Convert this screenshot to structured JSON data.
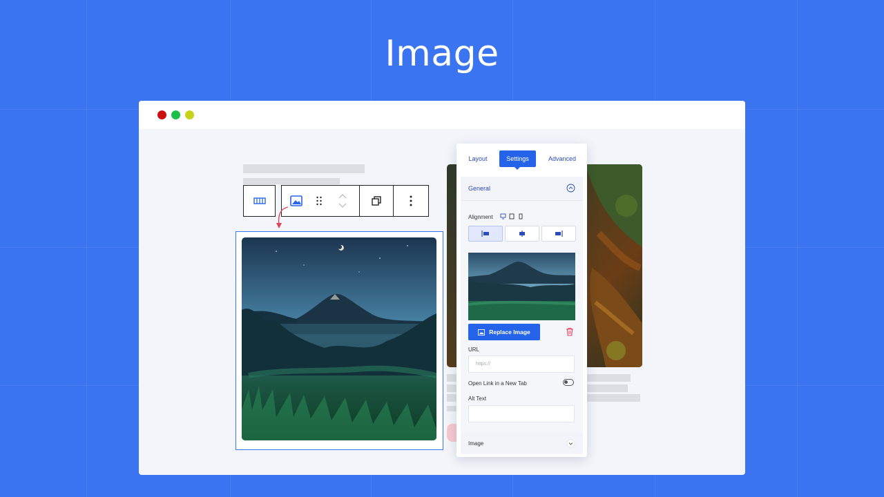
{
  "hero": {
    "title": "Image"
  },
  "window": {
    "dots": [
      "close",
      "minimize",
      "maximize"
    ]
  },
  "toolbar": {
    "buttons": [
      "columns-icon",
      "image-icon",
      "drag-handle-icon",
      "move-up-icon",
      "move-down-icon",
      "duplicate-icon",
      "more-options-icon"
    ]
  },
  "panel": {
    "tabs": {
      "layout": "Layout",
      "settings": "Settings",
      "advanced": "Advanced"
    },
    "general_title": "General",
    "alignment_label": "Alignment",
    "replace_label": "Replace Image",
    "url_label": "URL",
    "url_placeholder": "https://",
    "new_tab_label": "Open Link in a New Tab",
    "alt_label": "Alt Text",
    "image_section_title": "Image"
  },
  "colors": {
    "background": "#3a74f0",
    "accent": "#2563eb",
    "delete": "#e0435a"
  }
}
